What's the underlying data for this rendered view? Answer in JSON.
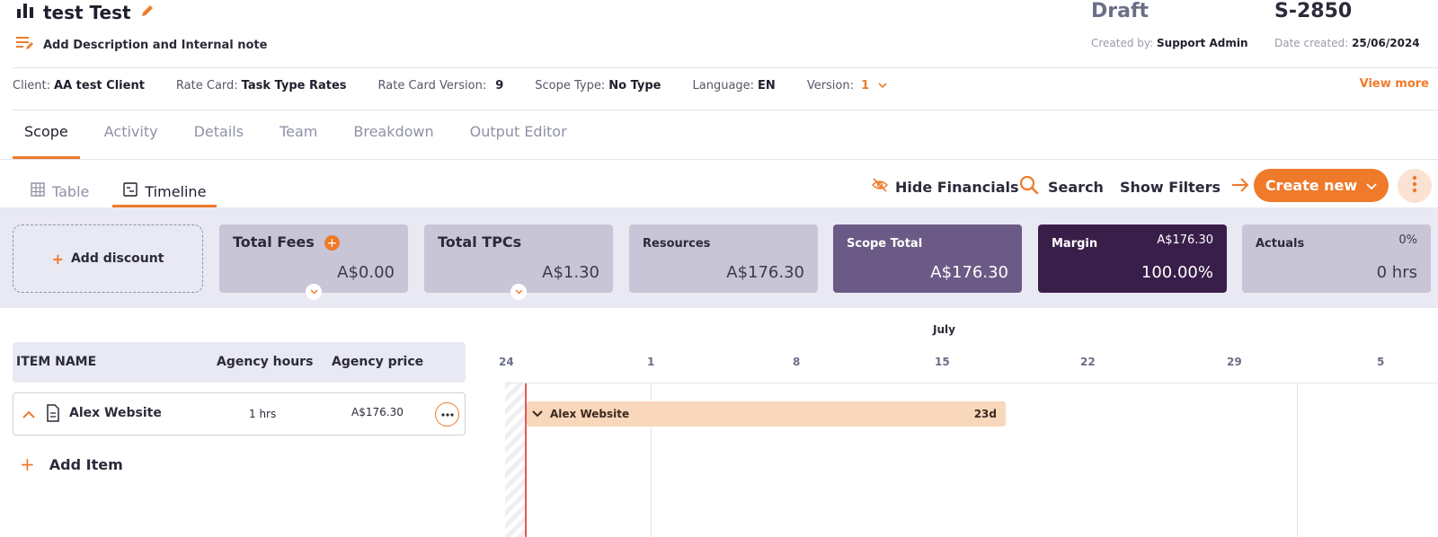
{
  "header": {
    "title": "test Test",
    "description_link": "Add Description and Internal note",
    "status": "Draft",
    "scope_number": "S-2850",
    "created_by_label": "Created by:",
    "created_by": "Support Admin",
    "date_created_label": "Date created:",
    "date_created": "25/06/2024"
  },
  "info": {
    "client_label": "Client:",
    "client": "AA test Client",
    "rate_card_label": "Rate Card:",
    "rate_card": "Task Type Rates",
    "rate_card_version_label": "Rate Card Version:",
    "rate_card_version": "9",
    "scope_type_label": "Scope Type:",
    "scope_type": "No Type",
    "language_label": "Language:",
    "language": "EN",
    "version_label": "Version:",
    "version": "1",
    "view_more": "View more"
  },
  "tabs": [
    "Scope",
    "Activity",
    "Details",
    "Team",
    "Breakdown",
    "Output Editor"
  ],
  "view_tabs": {
    "table": "Table",
    "timeline": "Timeline"
  },
  "toolbar": {
    "hide_financials": "Hide Financials",
    "search": "Search",
    "show_filters": "Show Filters",
    "create_new": "Create new"
  },
  "summary": {
    "add_discount": "Add discount",
    "total_fees_label": "Total Fees",
    "total_fees": "A$0.00",
    "total_tpcs_label": "Total TPCs",
    "total_tpcs": "A$1.30",
    "resources_label": "Resources",
    "resources": "A$176.30",
    "scope_total_label": "Scope Total",
    "scope_total": "A$176.30",
    "margin_label": "Margin",
    "margin_amount": "A$176.30",
    "margin_percent": "100.00%",
    "actuals_label": "Actuals",
    "actuals_percent": "0%",
    "actuals_hours": "0 hrs"
  },
  "table": {
    "headers": {
      "item_name": "ITEM NAME",
      "agency_hours": "Agency hours",
      "agency_price": "Agency price"
    },
    "rows": [
      {
        "name": "Alex Website",
        "hours": "1 hrs",
        "price": "A$176.30"
      }
    ],
    "add_item": "Add Item"
  },
  "timeline": {
    "month": "July",
    "ticks": [
      "24",
      "1",
      "8",
      "15",
      "22",
      "29",
      "5"
    ],
    "bar_label": "Alex Website",
    "bar_duration": "23d"
  },
  "colors": {
    "accent": "#ef7a2a",
    "scope_total_card": "#6b5a86",
    "margin_card": "#3a1e4a",
    "summary_card": "#c8c5d6",
    "timeline_bar": "#f8d7bb",
    "today_line": "#e4585a"
  }
}
